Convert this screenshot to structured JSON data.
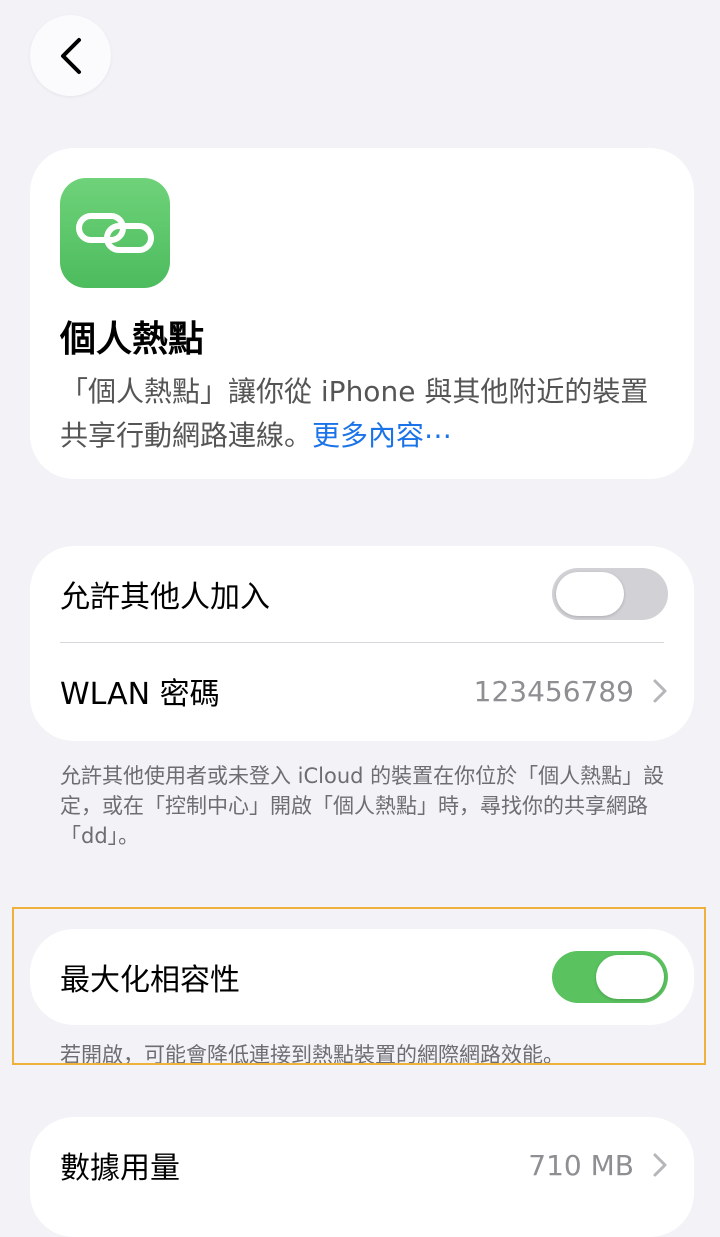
{
  "nav": {
    "back_icon": "chevron-left-icon"
  },
  "header": {
    "icon": "link-chain-icon",
    "title": "個人熱點",
    "description": "「個人熱點」讓你從 iPhone 與其他附近的裝置共享行動網路連線。",
    "more_link": "更多內容⋯"
  },
  "access": {
    "allow_others_label": "允許其他人加入",
    "allow_others_on": false,
    "wlan_label": "WLAN 密碼",
    "wlan_value": "123456789",
    "footnote": "允許其他使用者或未登入 iCloud 的裝置在你位於「個人熱點」設定，或在「控制中心」開啟「個人熱點」時，尋找你的共享網路「dd」。"
  },
  "compat": {
    "label": "最大化相容性",
    "on": true,
    "footnote": "若開啟，可能會降低連接到熱點裝置的網際網路效能。"
  },
  "usage": {
    "label": "數據用量",
    "value": "710 MB"
  },
  "colors": {
    "accent_green": "#5ac25f",
    "link_blue": "#1a73e8",
    "highlight_orange": "#f0b13c"
  }
}
